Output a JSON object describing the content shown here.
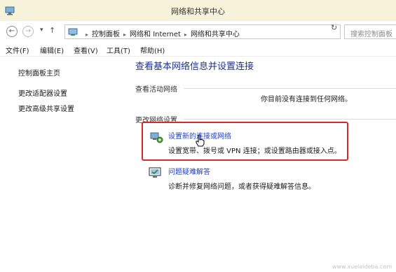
{
  "window": {
    "title": "网络和共享中心"
  },
  "nav": {
    "back": "←",
    "forward": "→",
    "history": "▾",
    "up": "↑"
  },
  "address": {
    "segments": [
      "控制面板",
      "网络和 Internet",
      "网络和共享中心"
    ],
    "separator": "▸",
    "dropdown": "⌄",
    "refresh": "↻"
  },
  "search": {
    "placeholder": "搜索控制面板"
  },
  "menu": [
    "文件(F)",
    "编辑(E)",
    "查看(V)",
    "工具(T)",
    "帮助(H)"
  ],
  "sidebar": {
    "links": [
      "控制面板主页",
      "更改适配器设置",
      "更改高级共享设置"
    ]
  },
  "main": {
    "heading": "查看基本网络信息并设置连接",
    "active_networks": {
      "label": "查看活动网络",
      "status": "你目前没有连接到任何网络。"
    },
    "change_settings": {
      "label": "更改网络设置",
      "tasks": [
        {
          "link": "设置新的连接或网络",
          "description": "设置宽带、拨号或 VPN 连接；或设置路由器或接入点。",
          "icon": "network-setup-icon"
        },
        {
          "link": "问题疑难解答",
          "description": "诊断并修复网络问题，或者获得疑难解答信息。",
          "icon": "troubleshoot-icon"
        }
      ]
    }
  },
  "watermark": "www.xuelaideba.com",
  "colors": {
    "title_bar": "#f7f3da",
    "heading": "#1e3287",
    "link": "#1c3ec8",
    "highlight_border": "#d42a2a"
  }
}
